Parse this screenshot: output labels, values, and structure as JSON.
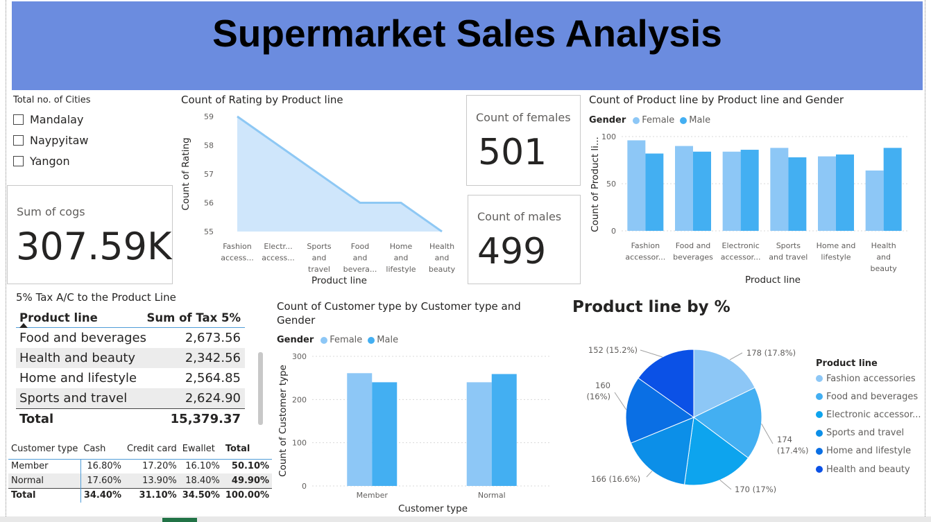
{
  "header": {
    "title": "Supermarket Sales Analysis"
  },
  "city_slicer": {
    "title": "Total no. of Cities",
    "items": [
      "Mandalay",
      "Naypyitaw",
      "Yangon"
    ]
  },
  "cards": {
    "cogs": {
      "label": "Sum of cogs",
      "value": "307.59K"
    },
    "females": {
      "label": "Count of females",
      "value": "501"
    },
    "males": {
      "label": "Count of males",
      "value": "499"
    }
  },
  "colors": {
    "banner": "#6b8cdf",
    "female": "#8dc7f6",
    "male": "#43aff2",
    "area_fill": "#cfe6fb",
    "area_line": "#8ec8f4",
    "pie": [
      "#8dc7f6",
      "#43aff2",
      "#0da4ee",
      "#0c8fe8",
      "#0a6fe4",
      "#0b51e6"
    ]
  },
  "tax_table": {
    "title": "5% Tax A/C to the Product Line",
    "headers": [
      "Product line",
      "Sum of Tax 5%"
    ],
    "rows": [
      [
        "Food and beverages",
        "2,673.56"
      ],
      [
        "Health and beauty",
        "2,342.56"
      ],
      [
        "Home and lifestyle",
        "2,564.85"
      ],
      [
        "Sports and travel",
        "2,624.90"
      ]
    ],
    "total": [
      "Total",
      "15,379.37"
    ]
  },
  "payment_table": {
    "headers": [
      "Customer type",
      "Cash",
      "Credit card",
      "Ewallet",
      "Total"
    ],
    "rows": [
      [
        "Member",
        "16.80%",
        "17.20%",
        "16.10%",
        "50.10%"
      ],
      [
        "Normal",
        "17.60%",
        "13.90%",
        "18.40%",
        "49.90%"
      ]
    ],
    "total": [
      "Total",
      "34.40%",
      "31.10%",
      "34.50%",
      "100.00%"
    ]
  },
  "chart_data": [
    {
      "id": "rating",
      "type": "area",
      "title": "Count of Rating by Product line",
      "xlabel": "Product line",
      "ylabel": "Count of Rating",
      "categories": [
        [
          "Fashion",
          "access..."
        ],
        [
          "Electr...",
          "access..."
        ],
        [
          "Sports",
          "and",
          "travel"
        ],
        [
          "Food",
          "and",
          "bevera..."
        ],
        [
          "Home",
          "and",
          "lifestyle"
        ],
        [
          "Health",
          "and",
          "beauty"
        ]
      ],
      "values": [
        59,
        58,
        57,
        56,
        56,
        55
      ],
      "ylim": [
        55,
        59
      ],
      "yticks": [
        55,
        56,
        57,
        58,
        59
      ]
    },
    {
      "id": "gender",
      "type": "bar",
      "title": "Count of Product line by Product line and Gender",
      "xlabel": "Product line",
      "ylabel": "Count of Product li...",
      "legend_title": "Gender",
      "categories": [
        [
          "Fashion",
          "accessor..."
        ],
        [
          "Food and",
          "beverages"
        ],
        [
          "Electronic",
          "accessor..."
        ],
        [
          "Sports",
          "and travel"
        ],
        [
          "Home and",
          "lifestyle"
        ],
        [
          "Health",
          "and",
          "beauty"
        ]
      ],
      "series": [
        {
          "name": "Female",
          "values": [
            96,
            90,
            84,
            88,
            79,
            64
          ]
        },
        {
          "name": "Male",
          "values": [
            82,
            84,
            86,
            78,
            81,
            88
          ]
        }
      ],
      "ylim": [
        0,
        100
      ],
      "yticks": [
        0,
        50,
        100
      ]
    },
    {
      "id": "customer",
      "type": "bar",
      "title": "Count of Customer type by Customer type and Gender",
      "title_lines": [
        "Count of Customer type by Customer type and",
        "Gender"
      ],
      "xlabel": "Customer type",
      "ylabel": "Count of Customer type",
      "legend_title": "Gender",
      "categories": [
        [
          "Member"
        ],
        [
          "Normal"
        ]
      ],
      "series": [
        {
          "name": "Female",
          "values": [
            261,
            240
          ]
        },
        {
          "name": "Male",
          "values": [
            240,
            259
          ]
        }
      ],
      "ylim": [
        0,
        300
      ],
      "yticks": [
        0,
        100,
        200,
        300
      ]
    },
    {
      "id": "pie",
      "type": "pie",
      "title": "Product line by %",
      "legend_title": "Product line",
      "labels": [
        "Fashion accessories",
        "Food and beverages",
        "Electronic accessor...",
        "Sports and travel",
        "Home and lifestyle",
        "Health and beauty"
      ],
      "values": [
        178,
        174,
        170,
        166,
        160,
        152
      ],
      "value_labels": [
        [
          "178 (17.8%)"
        ],
        [
          "174",
          "(17.4%)"
        ],
        [
          "170 (17%)"
        ],
        [
          "166 (16.6%)"
        ],
        [
          "160",
          "(16%)"
        ],
        [
          "152 (15.2%)"
        ]
      ]
    }
  ]
}
